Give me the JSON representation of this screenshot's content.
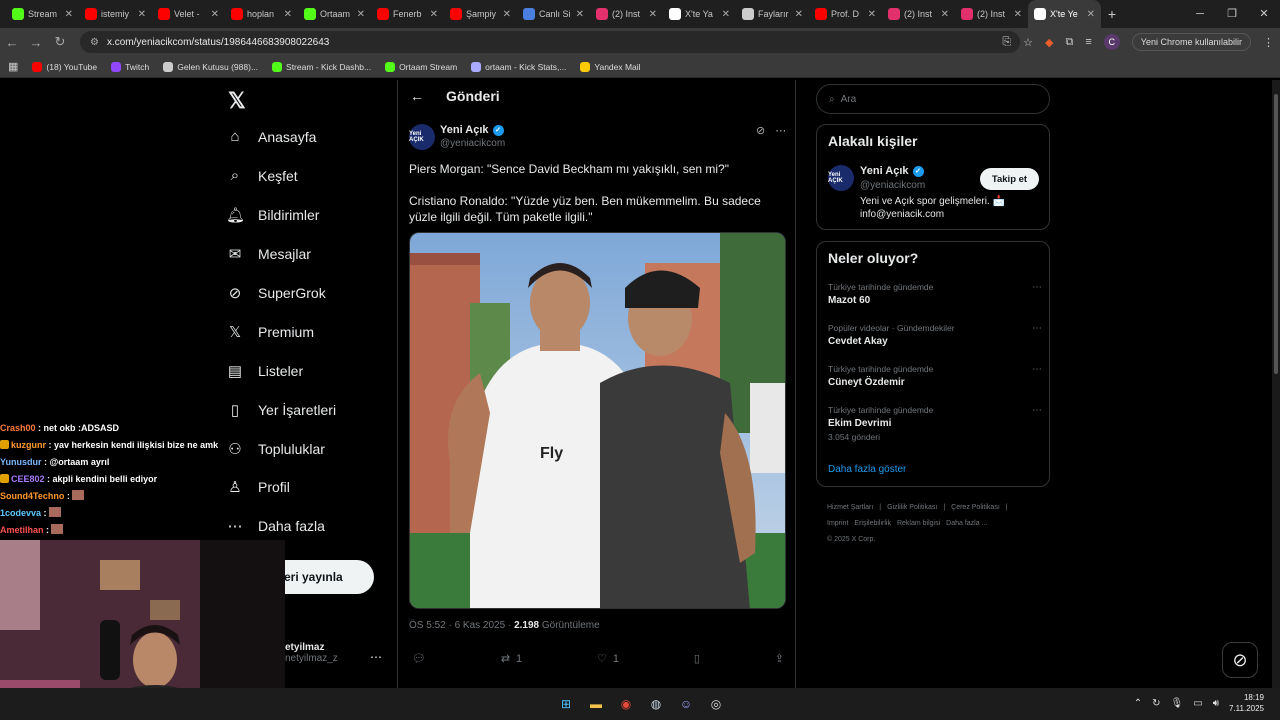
{
  "browser": {
    "tabs": [
      {
        "label": "Stream",
        "icon": "kick-icon",
        "color": "#53fc18"
      },
      {
        "label": "istemiy",
        "icon": "youtube-icon",
        "color": "#ff0000"
      },
      {
        "label": "Velet -",
        "icon": "youtube-icon",
        "color": "#ff0000"
      },
      {
        "label": "hoplan",
        "icon": "youtube-icon",
        "color": "#ff0000"
      },
      {
        "label": "Ortaam",
        "icon": "kick-icon",
        "color": "#53fc18"
      },
      {
        "label": "Fenerb",
        "icon": "youtube-icon",
        "color": "#ff0000"
      },
      {
        "label": "Şampiy",
        "icon": "youtube-icon",
        "color": "#ff0000"
      },
      {
        "label": "Canlı Si",
        "icon": "m-icon",
        "color": "#4a7fe0"
      },
      {
        "label": "(2) Inst",
        "icon": "instagram-icon",
        "color": "#e1306c"
      },
      {
        "label": "X'te Ya",
        "icon": "x-icon",
        "color": "#ffffff"
      },
      {
        "label": "Faylarır",
        "icon": "globe-icon",
        "color": "#cccccc"
      },
      {
        "label": "Prof. D",
        "icon": "youtube-icon",
        "color": "#ff0000"
      },
      {
        "label": "(2) Inst",
        "icon": "instagram-icon",
        "color": "#e1306c"
      },
      {
        "label": "(2) Inst",
        "icon": "instagram-icon",
        "color": "#e1306c"
      },
      {
        "label": "X'te Ye",
        "icon": "x-icon",
        "color": "#ffffff",
        "active": true
      }
    ],
    "url": "x.com/yeniacikcom/status/1986446683908022643",
    "update_button": "Yeni Chrome kullanılabilir",
    "profile_initial": "C",
    "bookmarks": [
      {
        "label": "(18) YouTube",
        "color": "#ff0000"
      },
      {
        "label": "Twitch",
        "color": "#9146ff"
      },
      {
        "label": "Gelen Kutusu (988)...",
        "color": "#cccccc"
      },
      {
        "label": "Stream - Kick Dashb...",
        "color": "#53fc18"
      },
      {
        "label": "Ortaam Stream",
        "color": "#53fc18"
      },
      {
        "label": "ortaam - Kick Stats,...",
        "color": "#aaaaff"
      },
      {
        "label": "Yandex Mail",
        "color": "#ffcc00"
      }
    ]
  },
  "nav": {
    "items": [
      {
        "label": "Anasayfa",
        "icon": "home-icon",
        "glyph": "⌂"
      },
      {
        "label": "Keşfet",
        "icon": "search-icon",
        "glyph": "⌕"
      },
      {
        "label": "Bildirimler",
        "icon": "bell-icon",
        "glyph": "🔔︎"
      },
      {
        "label": "Mesajlar",
        "icon": "mail-icon",
        "glyph": "✉"
      },
      {
        "label": "SuperGrok",
        "icon": "grok-icon",
        "glyph": "⊘"
      },
      {
        "label": "Premium",
        "icon": "x-premium-icon",
        "glyph": "𝕏"
      },
      {
        "label": "Listeler",
        "icon": "list-icon",
        "glyph": "▤"
      },
      {
        "label": "Yer İşaretleri",
        "icon": "bookmark-icon",
        "glyph": "▯"
      },
      {
        "label": "Topluluklar",
        "icon": "communities-icon",
        "glyph": "⚇"
      },
      {
        "label": "Profil",
        "icon": "profile-icon",
        "glyph": "♙"
      },
      {
        "label": "Daha fazla",
        "icon": "more-icon",
        "glyph": "⋯"
      }
    ],
    "post_button": "eri yayınla",
    "profile_name": "etyilmaz",
    "profile_handle": "netyilmaz_z"
  },
  "post": {
    "header": "Gönderi",
    "author_name": "Yeni Açık",
    "author_handle": "@yeniacikcom",
    "avatar_text": "Yeni AÇIK",
    "text_1": "Piers Morgan: \"Sence David Beckham mı yakışıklı, sen mi?\"",
    "text_2": "Cristiano Ronaldo: \"Yüzde yüz ben. Ben mükemmelim. Bu sadece yüzle ilgili değil. Tüm paketle ilgili.\"",
    "time": "ÖS 5:52 · 6 Kas 2025 ·",
    "views": "2.198",
    "views_label": "Görüntüleme",
    "retweets": "1",
    "likes": "1"
  },
  "sidebar": {
    "search_placeholder": "Ara",
    "related_title": "Alakalı kişiler",
    "related_name": "Yeni Açık",
    "related_handle": "@yeniacikcom",
    "related_bio": "Yeni ve Açık spor gelişmeleri. 📩 info@yeniacik.com",
    "follow_label": "Takip et",
    "trends_title": "Neler oluyor?",
    "trends": [
      {
        "context": "Türkiye tarihinde gündemde",
        "name": "Mazot 60",
        "posts": ""
      },
      {
        "context": "Popüler videolar · Gündemdekiler",
        "name": "Cevdet Akay",
        "posts": ""
      },
      {
        "context": "Türkiye tarihinde gündemde",
        "name": "Cüneyt Özdemir",
        "posts": ""
      },
      {
        "context": "Türkiye tarihinde gündemde",
        "name": "Ekim Devrimi",
        "posts": "3.054 gönderi"
      }
    ],
    "show_more": "Daha fazla göster",
    "footer_links": [
      "Hizmet Şartları",
      "|",
      "Gizlilik Politikası",
      "|",
      "Çerez Politikası",
      "|",
      "Imprint",
      "Erişilebilirlik",
      "Reklam bilgisi",
      "Daha fazla ...",
      "© 2025 X Corp."
    ]
  },
  "chat": [
    {
      "user": "Crash00",
      "color": "#ff7a3c",
      "msg": ": net okb :ADSASD",
      "badge": false
    },
    {
      "user": "kuzgunr",
      "color": "#ff9a2e",
      "msg": ": yav herkesin kendi ilişkisi bize ne amk",
      "badge": true
    },
    {
      "user": "Yunusdur",
      "color": "#7ab8ff",
      "msg": ": @ortaam ayrıl",
      "badge": false
    },
    {
      "user": "CEE802",
      "color": "#a77bff",
      "msg": ": akpli kendini belli ediyor",
      "badge": true
    },
    {
      "user": "Sound4Techno",
      "color": "#ff9a2e",
      "msg": ":",
      "badge": false
    },
    {
      "user": "1codevva",
      "color": "#5cc9ff",
      "msg": ":",
      "badge": false
    },
    {
      "user": "Ametilhan",
      "color": "#ff5050",
      "msg": ":",
      "badge": false
    }
  ],
  "taskbar": {
    "time": "18:19",
    "date": "7.11.2025"
  }
}
